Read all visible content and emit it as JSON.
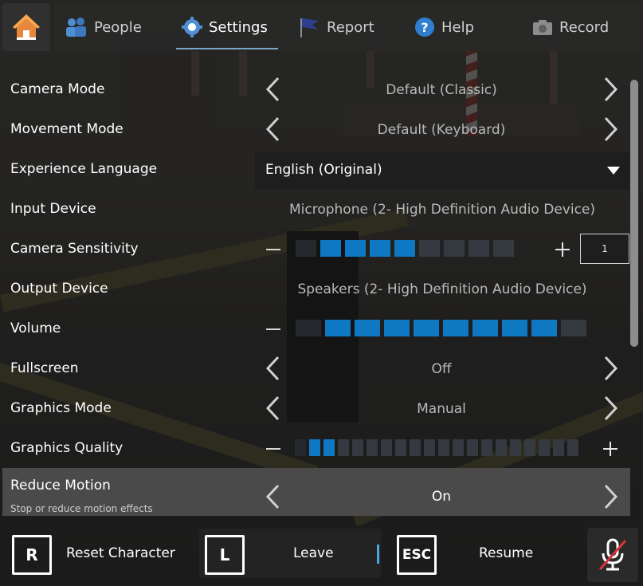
{
  "tabs": [
    {
      "label": "People",
      "icon": "people-icon"
    },
    {
      "label": "Settings",
      "icon": "settings-gear-icon"
    },
    {
      "label": "Report",
      "icon": "report-flag-icon"
    },
    {
      "label": "Help",
      "icon": "help-icon"
    },
    {
      "label": "Record",
      "icon": "camera-icon"
    }
  ],
  "active_tab": "Settings",
  "settings": {
    "camera_mode": {
      "label": "Camera Mode",
      "value": "Default (Classic)"
    },
    "movement_mode": {
      "label": "Movement Mode",
      "value": "Default (Keyboard)"
    },
    "experience_language": {
      "label": "Experience Language",
      "value": "English (Original)"
    },
    "input_device": {
      "label": "Input Device",
      "value": "Microphone (2- High Definition Audio Device)"
    },
    "camera_sensitivity": {
      "label": "Camera Sensitivity",
      "value": "1",
      "level": 4,
      "max": 10
    },
    "output_device": {
      "label": "Output Device",
      "value": "Speakers (2- High Definition Audio Device)"
    },
    "volume": {
      "label": "Volume",
      "level": 8,
      "max": 10
    },
    "fullscreen": {
      "label": "Fullscreen",
      "value": "Off"
    },
    "graphics_mode": {
      "label": "Graphics Mode",
      "value": "Manual"
    },
    "graphics_quality": {
      "label": "Graphics Quality",
      "level": 2,
      "max": 20
    },
    "reduce_motion": {
      "label": "Reduce Motion",
      "sublabel": "Stop or reduce motion effects",
      "value": "On"
    }
  },
  "bottom": {
    "reset": {
      "key": "R",
      "label": "Reset Character"
    },
    "leave": {
      "key": "L",
      "label": "Leave"
    },
    "resume": {
      "key": "ESC",
      "label": "Resume"
    }
  },
  "colors": {
    "accent": "#0f78c2",
    "panel": "#2b2b2a",
    "highlight_row": "#4a4a4a"
  }
}
